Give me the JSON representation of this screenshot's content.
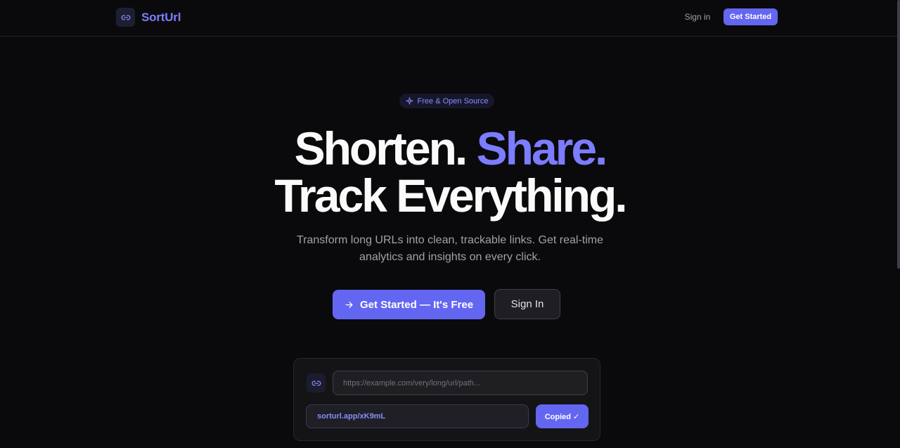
{
  "colors": {
    "background": "#0a0a0c",
    "accent": "#6366f1",
    "accent_text": "#7c7cff"
  },
  "header": {
    "brand_name": "SortUrl",
    "brand_icon": "link-icon",
    "sign_in_label": "Sign in",
    "get_started_label": "Get Started"
  },
  "hero": {
    "badge_icon": "sparkle-icon",
    "badge_label": "Free & Open Source",
    "headline_line1_a": "Shorten.",
    "headline_line1_b": "Share.",
    "headline_line2": "Track Everything.",
    "subtitle_line1": "Transform long URLs into clean, trackable links. Get real-time",
    "subtitle_line2": "analytics and insights on every click.",
    "primary_cta_icon": "arrow-right-icon",
    "primary_cta_label": "Get Started — It's Free",
    "secondary_cta_label": "Sign In"
  },
  "demo": {
    "link_icon": "link-icon",
    "url_placeholder": "https://example.com/very/long/url/path...",
    "url_value": "",
    "short_url": "sorturl.app/xK9mL",
    "copy_button_label": "Copied ✓"
  }
}
